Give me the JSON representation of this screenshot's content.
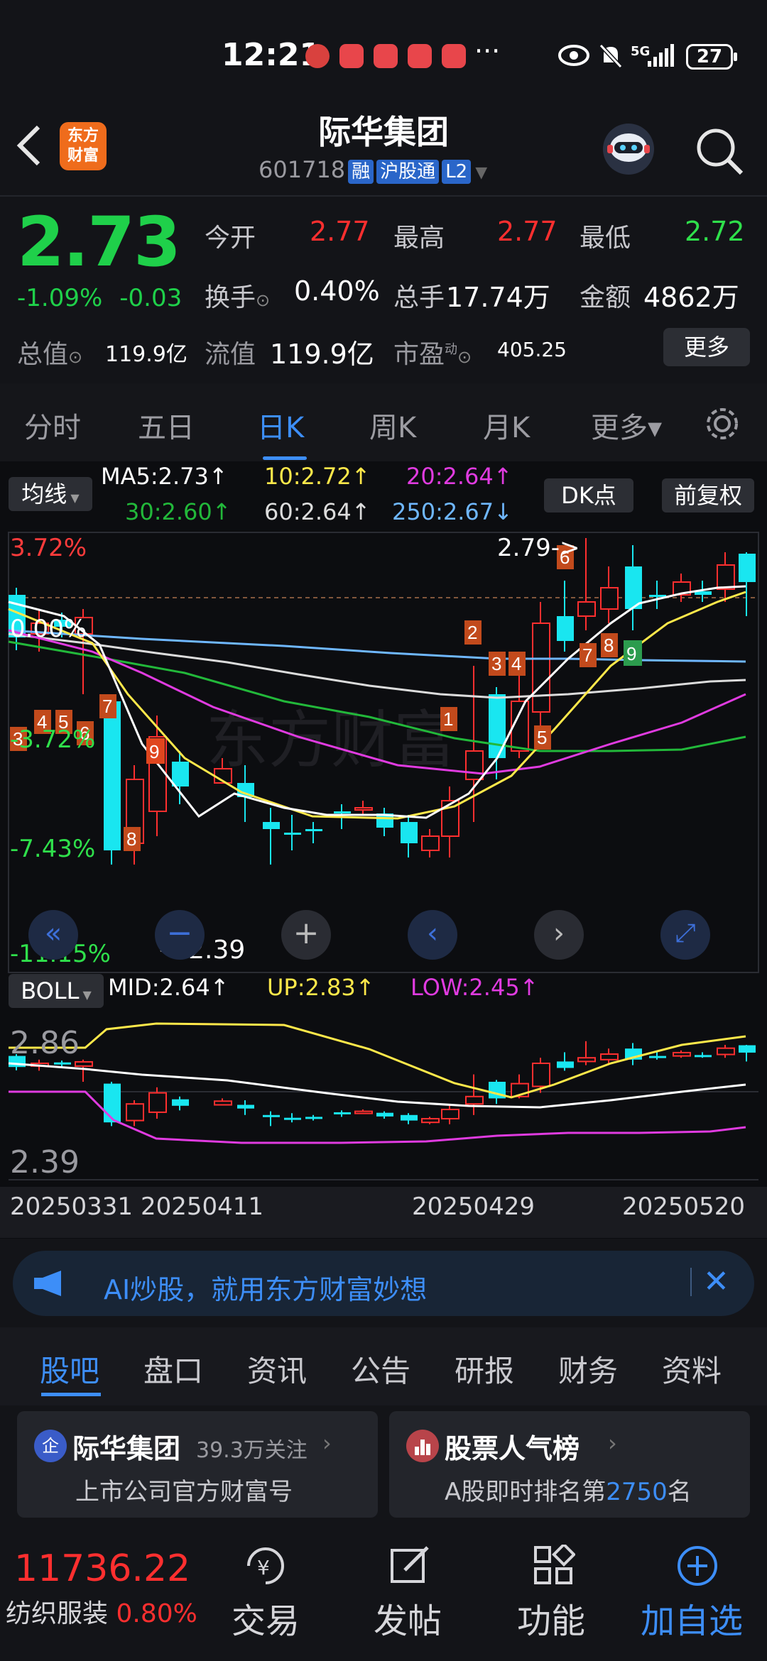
{
  "status": {
    "time": "12:21",
    "dots": "···",
    "battery": "27",
    "network": "5G"
  },
  "header": {
    "title": "际华集团",
    "code": "601718",
    "tags": [
      "融",
      "沪股通",
      "L2"
    ],
    "logo_line1": "东方",
    "logo_line2": "财富"
  },
  "quote": {
    "price": "2.73",
    "pct": "-1.09%",
    "chg": "-0.03",
    "open_label": "今开",
    "open": "2.77",
    "high_label": "最高",
    "high": "2.77",
    "low_label": "最低",
    "low": "2.72",
    "turnover_label": "换手",
    "turnover": "0.40%",
    "volume_label": "总手",
    "volume": "17.74万",
    "amount_label": "金额",
    "amount": "4862万",
    "mcap_label": "总值",
    "mcap": "119.9亿",
    "float_label": "流值",
    "float": "119.9亿",
    "pe_label": "市盈",
    "pe_sup": "动",
    "pe": "405.25",
    "more": "更多"
  },
  "tabs": [
    "分时",
    "五日",
    "日K",
    "周K",
    "月K",
    "更多▾"
  ],
  "chart": {
    "ma_select": "均线",
    "ma5": "MA5:2.73↑",
    "ma10": "10:2.72↑",
    "ma20": "20:2.64↑",
    "ma30": "30:2.60↑",
    "ma60": "60:2.64↑",
    "ma250": "250:2.67↓",
    "dk": "DK点",
    "adj": "前复权",
    "pct_top": "3.72%",
    "pct_zero": "0.00%",
    "pct_m1": "-3.72%",
    "pct_m2": "-7.43%",
    "pct_m3": "-11.15%",
    "high_label": "2.79->",
    "low_label": "<-2.39",
    "boll_select": "BOLL",
    "boll_mid": "MID:2.64↑",
    "boll_up": "UP:2.83↑",
    "boll_low": "LOW:2.45↑",
    "boll_top": "2.86",
    "boll_bot": "2.39",
    "dates": [
      "20250331",
      "20250411",
      "20250429",
      "20250520"
    ]
  },
  "colors": {
    "up": "#ff2f2f",
    "down": "#1fd04a",
    "accent": "#3d8ef8",
    "ma5": "#ffffff",
    "ma10": "#ffe84a",
    "ma20": "#e03be0",
    "ma30": "#22b83a",
    "ma60": "#dcdcdc",
    "ma250": "#6fb7ff"
  },
  "ai_banner": "AI炒股，就用东方财富妙想",
  "bottom_tabs": [
    "股吧",
    "盘口",
    "资讯",
    "公告",
    "研报",
    "财务",
    "资料"
  ],
  "card1": {
    "badge": "企",
    "name": "际华集团",
    "follow": "39.3万关注",
    "desc": "上市公司官方财富号"
  },
  "card2": {
    "name": "股票人气榜",
    "desc_pre": "A股即时排名第",
    "rank": "2750",
    "desc_post": "名"
  },
  "bottom": {
    "index": "11736.22",
    "sector": "纺织服装",
    "sector_pct": "0.80%",
    "trade": "交易",
    "post": "发帖",
    "func": "功能",
    "add": "加自选"
  }
}
